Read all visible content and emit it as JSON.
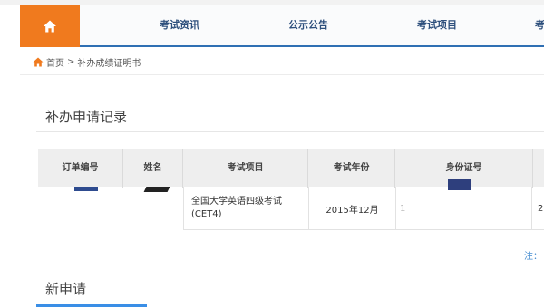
{
  "nav": {
    "home_label": "home",
    "items": [
      {
        "label": "考试资讯"
      },
      {
        "label": "公示公告"
      },
      {
        "label": "考试项目"
      },
      {
        "label": "考"
      }
    ]
  },
  "breadcrumb": {
    "home": "首页",
    "separator": ">",
    "current": "补办成绩证明书"
  },
  "records": {
    "title": "补办申请记录",
    "columns": [
      "订单编号",
      "姓名",
      "考试项目",
      "考试年份",
      "身份证号"
    ],
    "rows": [
      {
        "order_no": "",
        "name": "",
        "exam": "全国大学英语四级考试(CET4)",
        "year": "2015年12月",
        "id_fragment": "1",
        "extra_fragment": "2"
      }
    ],
    "note": "注："
  },
  "new_application": {
    "title": "新申请"
  },
  "colors": {
    "home_orange": "#f07a1e",
    "nav_text": "#2d4f7c",
    "nav_border": "#2f6fb3",
    "accent_blue": "#3a8ee6"
  }
}
